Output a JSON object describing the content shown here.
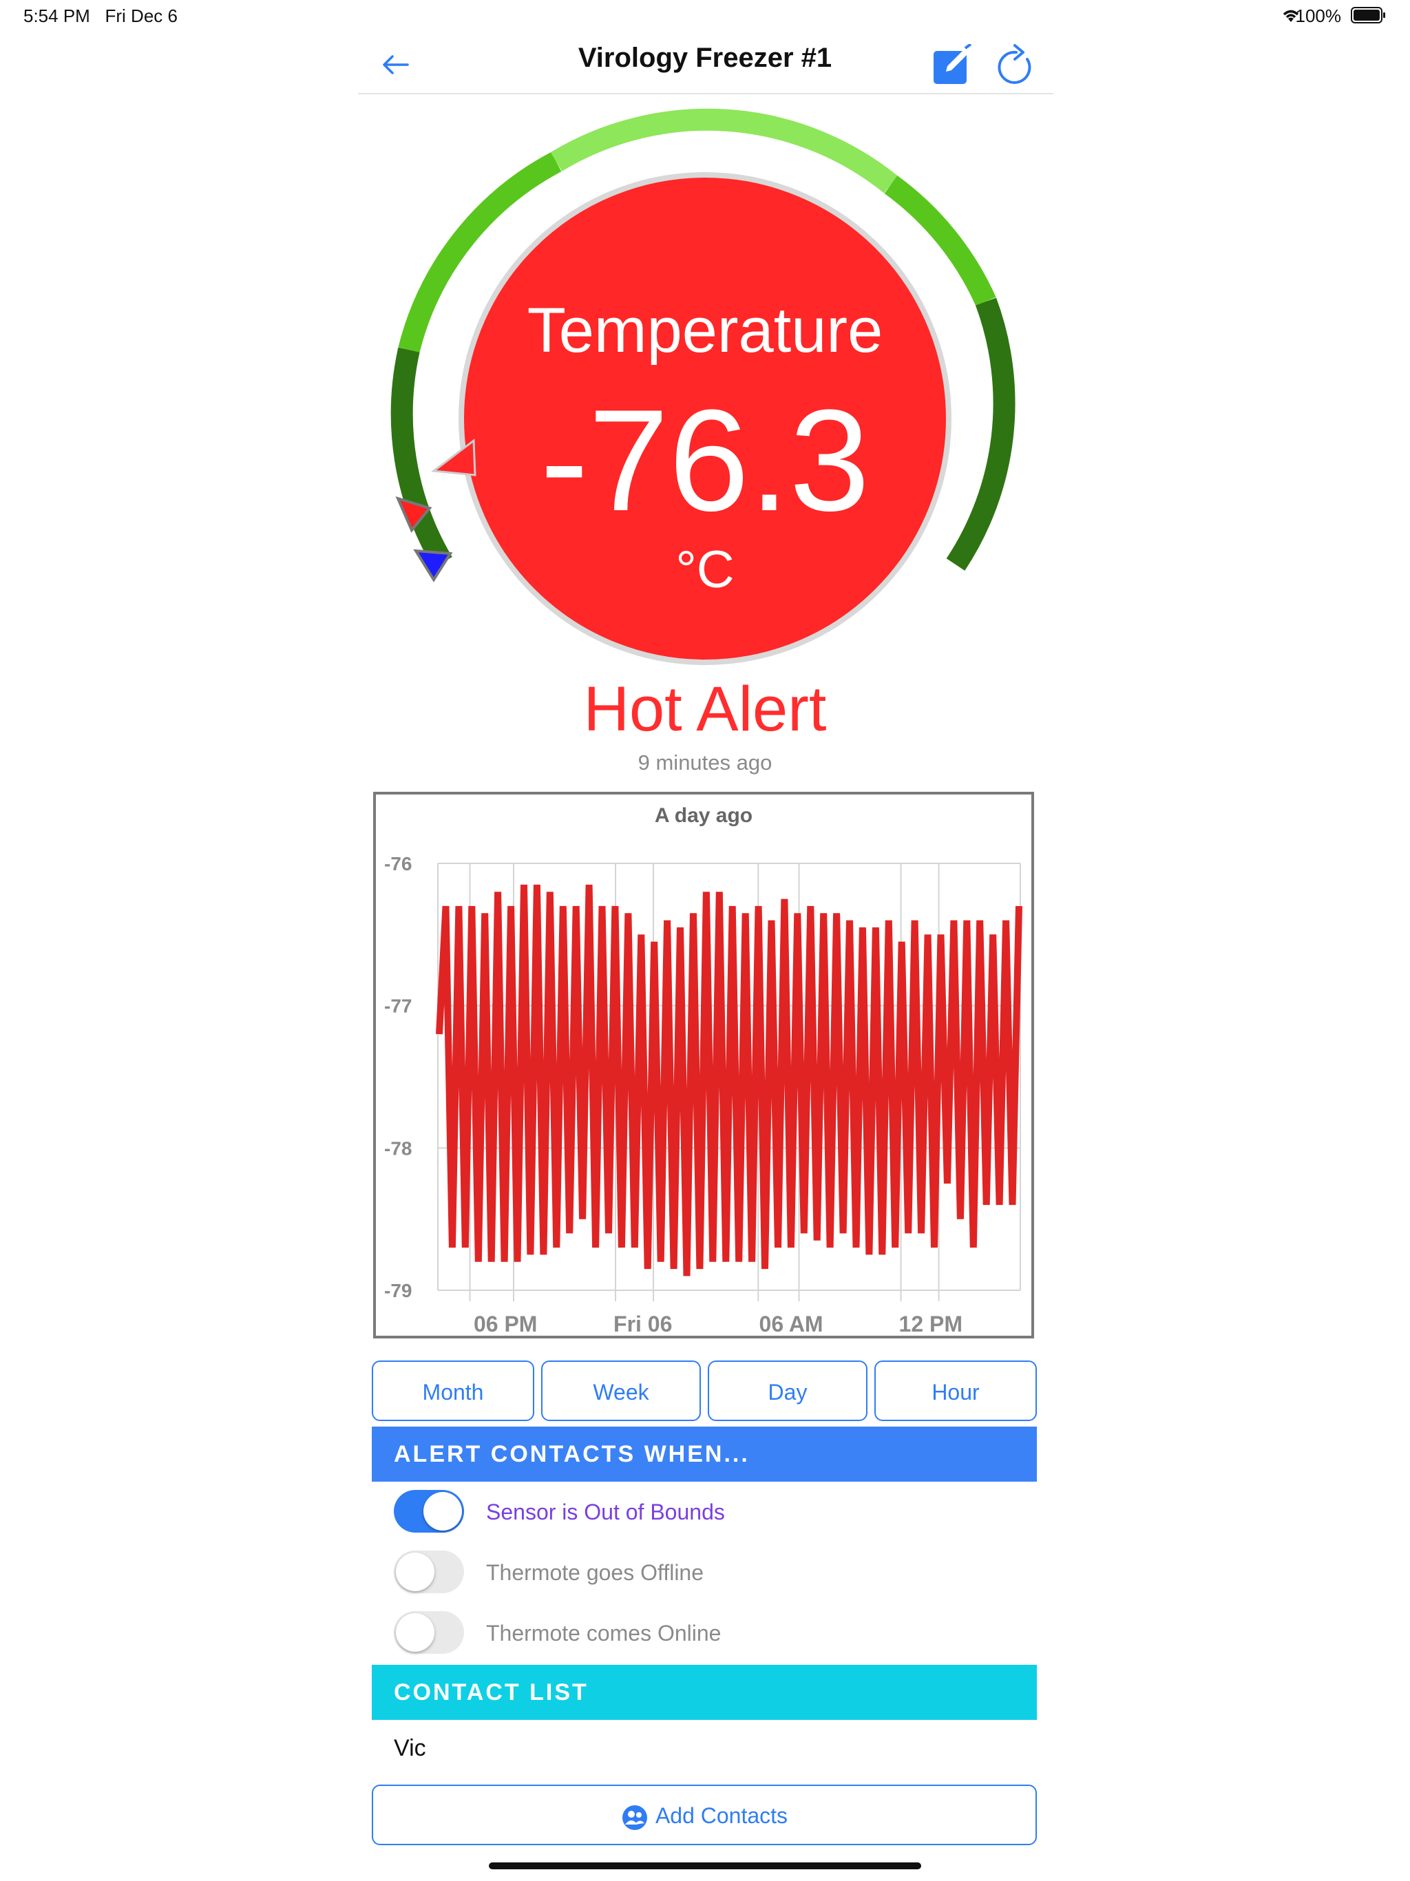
{
  "status_bar": {
    "time": "5:54 PM",
    "date": "Fri Dec 6",
    "battery": "100%"
  },
  "nav": {
    "title": "Virology Freezer #1",
    "back_icon": "back-arrow-icon",
    "edit_icon": "edit-icon",
    "refresh_icon": "refresh-icon"
  },
  "gauge": {
    "label": "Temperature",
    "value": "-76.3",
    "unit": "°C",
    "fill_color": "#ff2727",
    "arc_colors": [
      "#2f7413",
      "#59c61d",
      "#8ee65a"
    ]
  },
  "alert": {
    "title": "Hot Alert",
    "subtitle": "9 minutes ago"
  },
  "chart_data": {
    "type": "line",
    "title": "A day ago",
    "xlabel": "",
    "ylabel": "",
    "ylim": [
      -79,
      -76
    ],
    "yticks": [
      "-76",
      "-77",
      "-78",
      "-79"
    ],
    "xticks": [
      "06 PM",
      "Fri 06",
      "06 AM",
      "12 PM"
    ],
    "grid": true,
    "series": [
      {
        "color": "#e02424",
        "values": [
          -77.2,
          -76.3,
          -78.7,
          -76.3,
          -78.7,
          -76.3,
          -78.8,
          -76.35,
          -78.8,
          -76.2,
          -78.8,
          -76.3,
          -78.8,
          -76.15,
          -78.75,
          -76.15,
          -78.75,
          -76.2,
          -78.7,
          -76.3,
          -78.6,
          -76.3,
          -78.5,
          -76.15,
          -78.7,
          -76.3,
          -78.6,
          -76.3,
          -78.7,
          -76.35,
          -78.7,
          -76.5,
          -78.85,
          -76.55,
          -78.8,
          -76.4,
          -78.85,
          -76.45,
          -78.9,
          -76.35,
          -78.85,
          -76.2,
          -78.8,
          -76.2,
          -78.8,
          -76.3,
          -78.8,
          -76.35,
          -78.8,
          -76.3,
          -78.85,
          -76.4,
          -78.7,
          -76.25,
          -78.7,
          -76.35,
          -78.6,
          -76.3,
          -78.65,
          -76.35,
          -78.7,
          -76.35,
          -78.6,
          -76.4,
          -78.7,
          -76.45,
          -78.75,
          -76.45,
          -78.75,
          -76.4,
          -78.7,
          -76.55,
          -78.6,
          -76.4,
          -78.6,
          -76.5,
          -78.7,
          -76.5,
          -78.25,
          -76.4,
          -78.5,
          -76.4,
          -78.7,
          -76.4,
          -78.4,
          -76.5,
          -78.4,
          -76.4,
          -78.4,
          -76.3
        ]
      }
    ]
  },
  "range_buttons": [
    "Month",
    "Week",
    "Day",
    "Hour"
  ],
  "alert_section": {
    "header": "ALERT CONTACTS WHEN...",
    "header_color": "#3b82f6",
    "options": [
      {
        "label": "Sensor is Out of Bounds",
        "on": true
      },
      {
        "label": "Thermote goes Offline",
        "on": false
      },
      {
        "label": "Thermote comes Online",
        "on": false
      }
    ]
  },
  "contacts": {
    "header": "CONTACT LIST",
    "header_color": "#0fcfe4",
    "items": [
      "Vic"
    ],
    "add_label": "Add Contacts",
    "add_icon": "contacts-icon"
  }
}
